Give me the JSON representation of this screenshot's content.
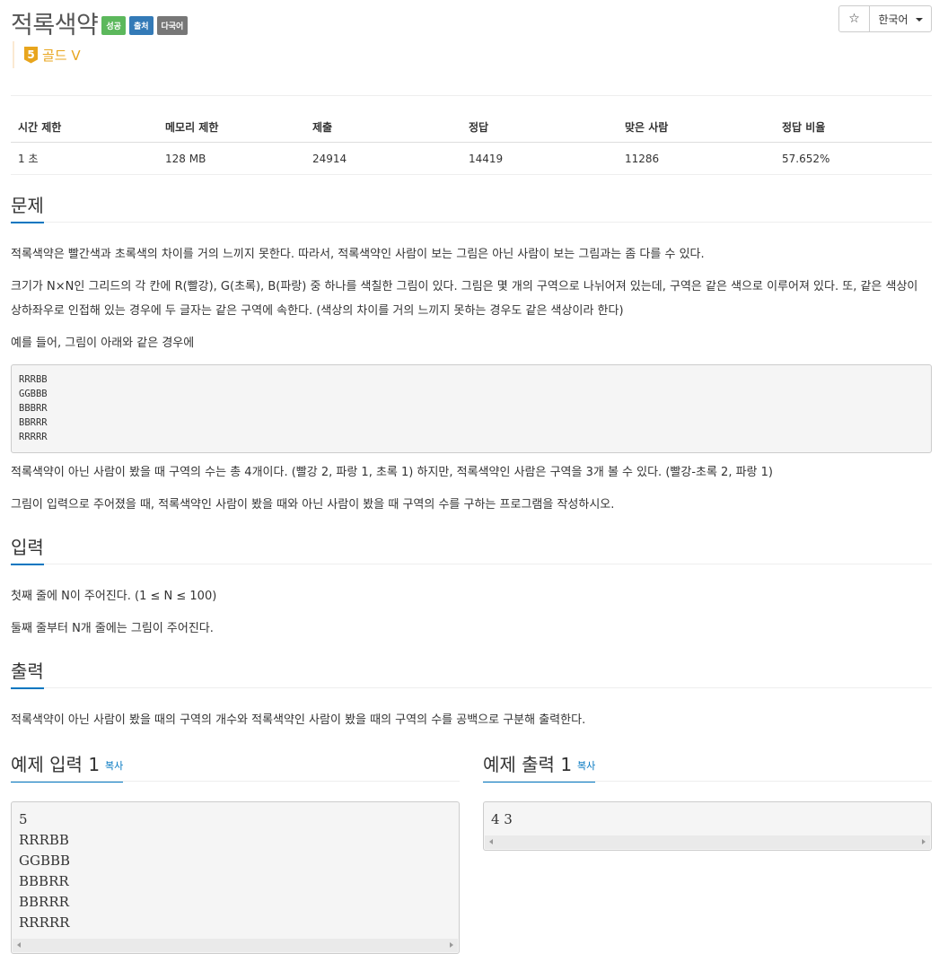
{
  "header": {
    "title": "적록색약",
    "labels": [
      {
        "text": "성공",
        "color": "#5cb85c"
      },
      {
        "text": "출처",
        "color": "#337ab7"
      },
      {
        "text": "다국어",
        "color": "#777777"
      }
    ],
    "star": "☆",
    "language": "한국어"
  },
  "tier": {
    "level": "5",
    "name": "골드 V",
    "color": "#e8a51d"
  },
  "info_table": {
    "headers": [
      "시간 제한",
      "메모리 제한",
      "제출",
      "정답",
      "맞은 사람",
      "정답 비율"
    ],
    "values": [
      "1 초",
      "128 MB",
      "24914",
      "14419",
      "11286",
      "57.652%"
    ]
  },
  "problem": {
    "title": "문제",
    "p1": "적록색약은 빨간색과 초록색의 차이를 거의 느끼지 못한다. 따라서, 적록색약인 사람이 보는 그림은 아닌 사람이 보는 그림과는 좀 다를 수 있다.",
    "p2": "크기가 N×N인 그리드의 각 칸에 R(빨강), G(초록), B(파랑) 중 하나를 색칠한 그림이 있다. 그림은 몇 개의 구역으로 나뉘어져 있는데, 구역은 같은 색으로 이루어져 있다. 또, 같은 색상이 상하좌우로 인접해 있는 경우에 두 글자는 같은 구역에 속한다. (색상의 차이를 거의 느끼지 못하는 경우도 같은 색상이라 한다)",
    "p3": "예를 들어, 그림이 아래와 같은 경우에",
    "grid": "RRRBB\nGGBBB\nBBBRR\nBBRRR\nRRRRR",
    "p4": "적록색약이 아닌 사람이 봤을 때 구역의 수는 총 4개이다. (빨강 2, 파랑 1, 초록 1) 하지만, 적록색약인 사람은 구역을 3개 볼 수 있다. (빨강-초록 2, 파랑 1)",
    "p5": "그림이 입력으로 주어졌을 때, 적록색약인 사람이 봤을 때와 아닌 사람이 봤을 때 구역의 수를 구하는 프로그램을 작성하시오."
  },
  "input": {
    "title": "입력",
    "p1": "첫째 줄에 N이 주어진다. (1 ≤ N ≤ 100)",
    "p2": "둘째 줄부터 N개 줄에는 그림이 주어진다."
  },
  "output": {
    "title": "출력",
    "p1": "적록색약이 아닌 사람이 봤을 때의 구역의 개수와 적록색약인 사람이 봤을 때의 구역의 수를 공백으로 구분해 출력한다."
  },
  "samples": {
    "input_title": "예제 입력 1",
    "output_title": "예제 출력 1",
    "copy": "복사",
    "input_text": "5\nRRRBB\nGGBBB\nBBBRR\nBBRRR\nRRRRR",
    "output_text": "4 3"
  }
}
